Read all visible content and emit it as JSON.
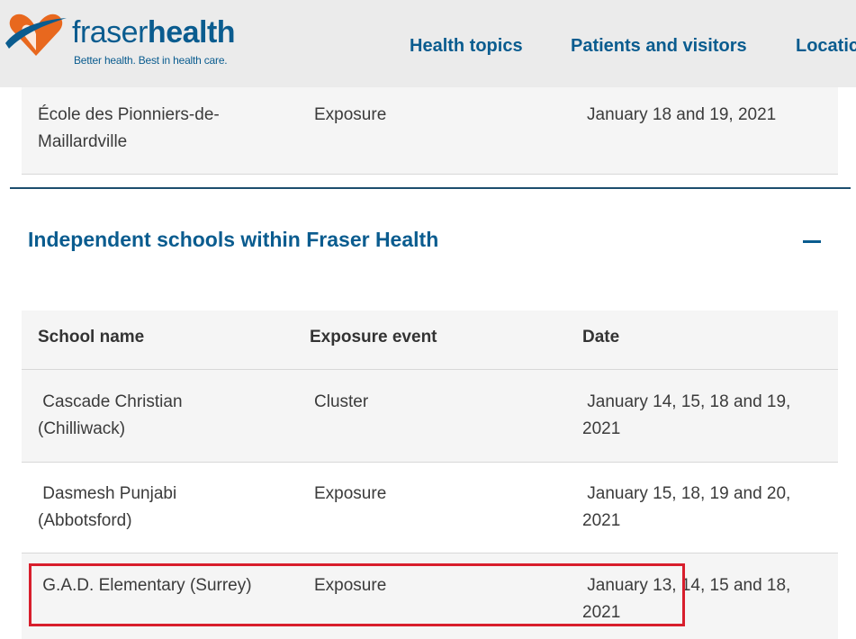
{
  "brand": {
    "name_part1": "fraser",
    "name_part2": "health",
    "tagline": "Better health. Best in health care.",
    "colors": {
      "primary": "#0a5c8f",
      "accent": "#e8681e",
      "highlight": "#d81e2c"
    }
  },
  "nav": {
    "items": [
      {
        "label": "Health topics"
      },
      {
        "label": "Patients and visitors"
      },
      {
        "label": "Locatic"
      }
    ]
  },
  "previous_table": {
    "rows": [
      {
        "school": "École des Pionniers-de-Maillardville",
        "school_line1": "École des Pionniers-de-",
        "school_line2": "Maillardville",
        "event": "Exposure",
        "date": "January 18 and 19, 2021"
      }
    ]
  },
  "section": {
    "title": "Independent schools within Fraser Health",
    "toggle_icon": "minus-icon"
  },
  "table": {
    "headers": [
      "School name",
      "Exposure event",
      "Date"
    ],
    "rows": [
      {
        "school_line1": " Cascade Christian",
        "school_line2": "(Chilliwack)",
        "event": "Cluster",
        "date_line1": " January 14, 15, 18 and 19,",
        "date_line2": "2021"
      },
      {
        "school_line1": " Dasmesh Punjabi",
        "school_line2": "(Abbotsford)",
        "event": "Exposure",
        "date_line1": " January 15, 18, 19 and 20,",
        "date_line2": "2021"
      },
      {
        "school_line1": " G.A.D. Elementary (Surrey)",
        "school_line2": "",
        "event": "Exposure",
        "date_line1": " January 13, 14, 15 and 18,",
        "date_line2": "2021"
      }
    ]
  }
}
